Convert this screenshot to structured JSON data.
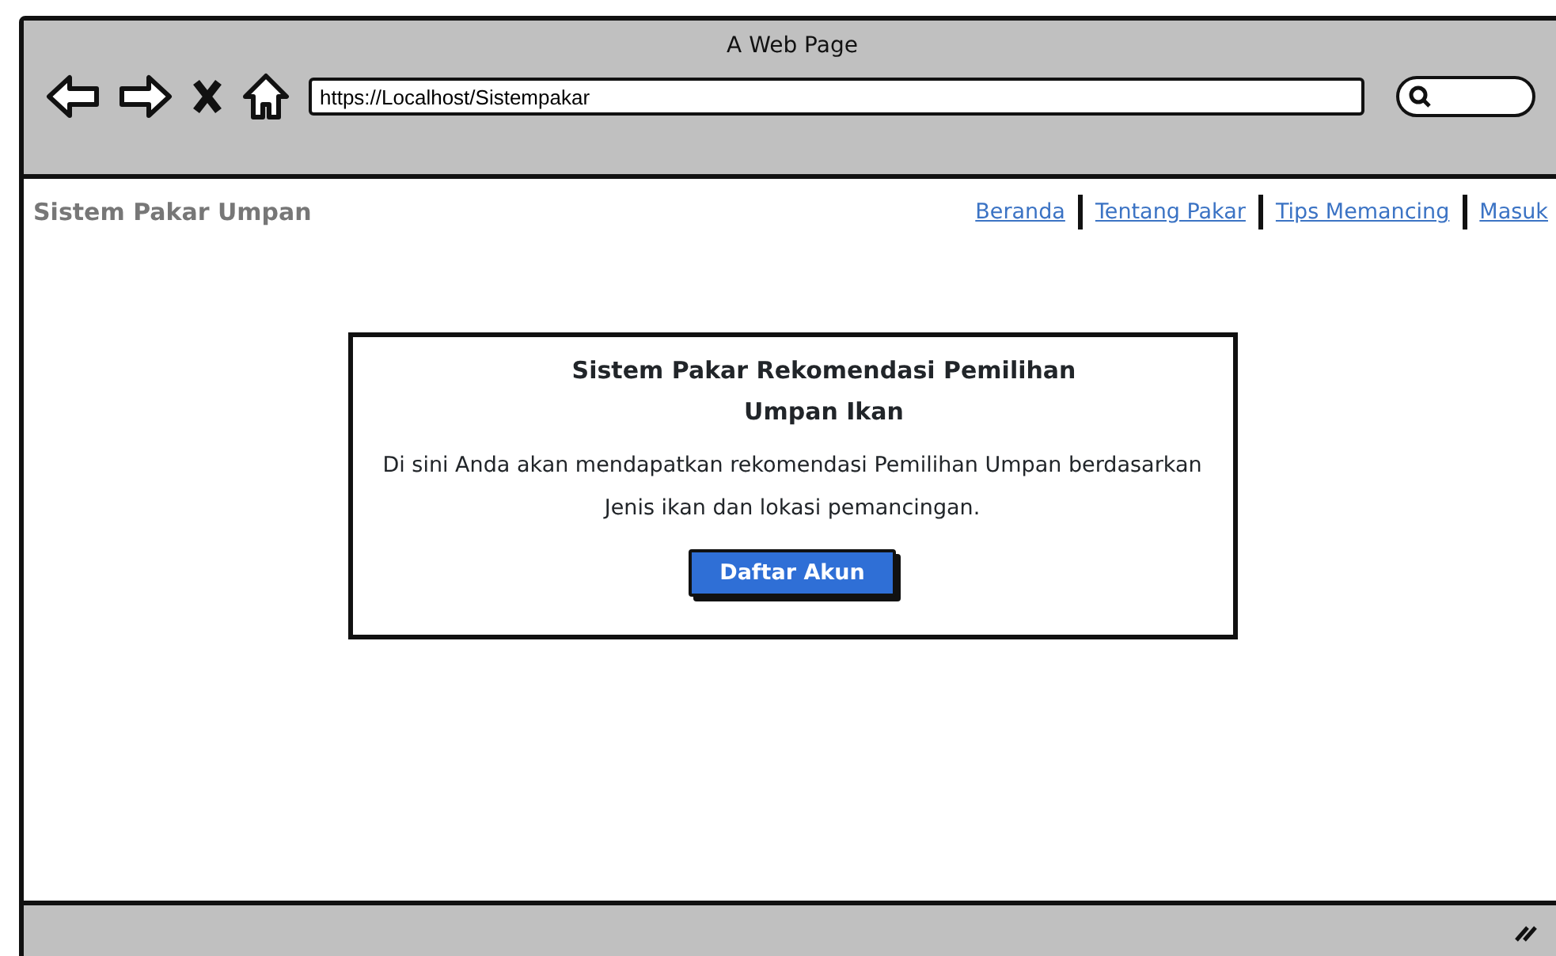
{
  "window": {
    "title": "A Web Page"
  },
  "address_bar": {
    "value": "https://Localhost/Sistempakar"
  },
  "navbar": {
    "brand": "Sistem Pakar Umpan",
    "links": [
      {
        "label": "Beranda"
      },
      {
        "label": "Tentang Pakar"
      },
      {
        "label": "Tips Memancing"
      },
      {
        "label": "Masuk"
      }
    ]
  },
  "hero": {
    "title": "Sistem Pakar Rekomendasi Pemilihan Umpan Ikan",
    "text": "Di sini Anda akan mendapatkan rekomendasi Pemilihan Umpan berdasarkan Jenis ikan dan lokasi pemancingan.",
    "button": "Daftar Akun"
  }
}
